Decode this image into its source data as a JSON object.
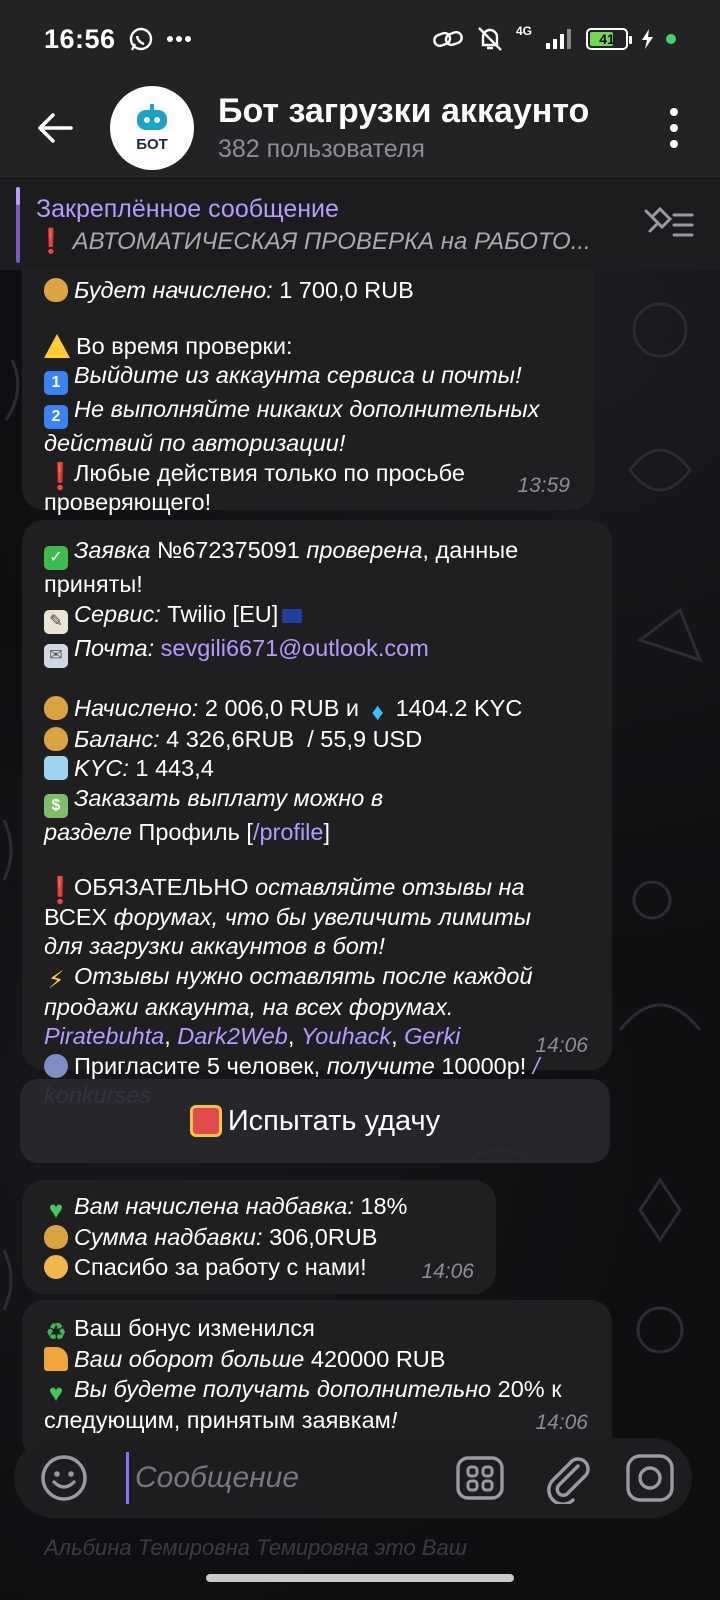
{
  "status_bar": {
    "time": "16:56",
    "network": "4G",
    "battery": "41"
  },
  "header": {
    "title": "Бот загрузки аккаунто",
    "subtitle": "382 пользователя",
    "avatar_text": "БОТ"
  },
  "pinned": {
    "title": "Закреплённое сообщение",
    "text": "АВТОМАТИЧЕСКАЯ ПРОВЕРКА на РАБОТО..."
  },
  "messages": {
    "m1": {
      "l1_label": "Будет начислено:",
      "l1_value": "1 700,0 RUB",
      "l2": "Во время проверки:",
      "l3": "Выйдите из аккаунта сервиса и почты!",
      "l4": "Не выполняйте никаких дополнительных",
      "l5": "действий по авторизации!",
      "l6": "Любые действия только по просьбе",
      "l7": "проверяющего!",
      "time": "13:59"
    },
    "m2": {
      "l1_label": "Заявка",
      "l1_num": "№672375091",
      "l1_mid": "проверена",
      "l1_end": ", данные",
      "l2": "приняты!",
      "service_label": "Сервис:",
      "service_value": "Twilio [EU]",
      "mail_label": "Почта:",
      "mail_value": "sevgili6671@outlook.com",
      "accrued_label": "Начислено:",
      "accrued_value": "2 006,0 RUB и",
      "accrued_kyc": "1404.2 KYC",
      "balance_label": "Баланс:",
      "balance_value": "4 326,6RUB  / 55,9 USD",
      "kyc_label": "KYC:",
      "kyc_value": "1 443,4",
      "payout_1": "Заказать выплату можно в",
      "payout_2_it": "разделе",
      "payout_2": "Профиль [",
      "payout_link": "/profile",
      "payout_end": "]",
      "req_bold": "ОБЯЗАТЕЛЬНО",
      "req_1": "оставляйте отзывы на",
      "req_2a": "ВСЕХ",
      "req_2b": "форумах, что бы увеличить лимиты",
      "req_3": "для загрузки аккаунтов в бот!",
      "rev_1": "Отзывы нужно оставлять после каждой",
      "rev_2": "продажи аккаунта, на всех форумах.",
      "forums": [
        "Piratebuhta",
        "Dark2Web",
        "Youhack",
        "Gerki"
      ],
      "invite_a": "Пригласите 5 человек,",
      "invite_b": "получите",
      "invite_c": "10000р!",
      "invite_link1": "/",
      "invite_link2": "konkurses",
      "time": "14:06"
    },
    "m3": {
      "l1_label": "Вам начислена надбавка:",
      "l1_value": "18%",
      "l2_label": "Сумма надбавки:",
      "l2_value": "306,0RUB",
      "l3": "Спасибо за работу с нами!",
      "time": "14:06"
    },
    "m4": {
      "l1": "Ваш бонус изменился",
      "l2_label": "Ваш оборот больше",
      "l2_value": "420000 RUB",
      "l3_label": "Вы будете получать дополнительно",
      "l3_value": "20% к",
      "l4_a": "следующим, принятым заявкам",
      "l4_b": "!",
      "time": "14:06"
    }
  },
  "keyboard_button": {
    "label": "Испытать удачу"
  },
  "input": {
    "placeholder": "Сообщение"
  },
  "under_text": "Альбина Темировна Темировна это Ваш",
  "icons": {
    "back": "arrow-left-icon",
    "menu": "more-vertical-icon",
    "unpin": "pinned-list-icon",
    "emoji": "emoji-icon",
    "bot_commands": "bot-menu-icon",
    "attach": "paperclip-icon",
    "camera": "camera-icon"
  },
  "colors": {
    "accent": "#b39bff",
    "bubble": "#1f1f22",
    "header": "#232325"
  }
}
